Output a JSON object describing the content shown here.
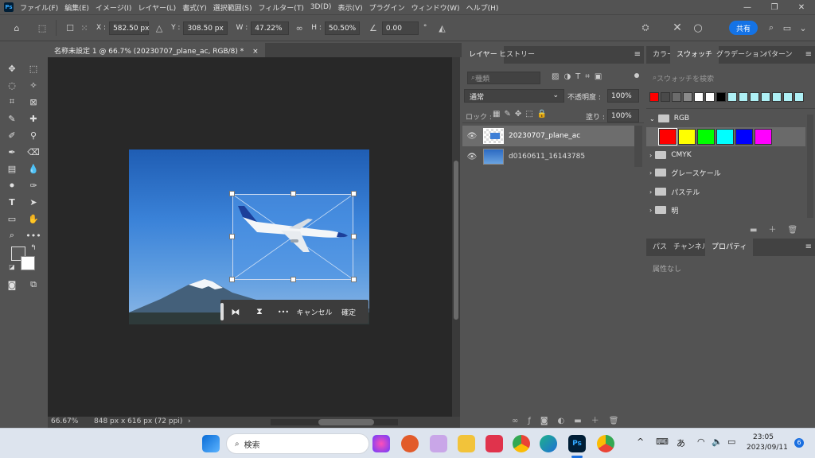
{
  "app": {
    "logo": "Ps"
  },
  "menu": {
    "items": [
      "ファイル(F)",
      "編集(E)",
      "イメージ(I)",
      "レイヤー(L)",
      "書式(Y)",
      "選択範囲(S)",
      "フィルター(T)",
      "3D(D)",
      "表示(V)",
      "プラグイン",
      "ウィンドウ(W)",
      "ヘルプ(H)"
    ]
  },
  "window_controls": {
    "minimize": "—",
    "restore": "❐",
    "close": "✕"
  },
  "options": {
    "x_label": "X :",
    "x_value": "582.50 px",
    "y_label": "Y :",
    "y_value": "308.50 px",
    "w_label": "W :",
    "w_value": "47.22%",
    "h_label": "H :",
    "h_value": "50.50%",
    "angle_value": "0.00",
    "degree": "°",
    "share_label": "共有"
  },
  "document": {
    "tab_title": "名称未設定 1 @ 66.7% (20230707_plane_ac, RGB/8) *",
    "close": "×",
    "zoom": "66.67%",
    "size_info": "848 px x 616 px (72 ppi)",
    "arrow": "›"
  },
  "context_bar": {
    "more": "•••",
    "cancel": "キャンセル",
    "confirm": "確定"
  },
  "layers_panel": {
    "tabs": [
      "レイヤー",
      "ヒストリー"
    ],
    "filter_placeholder": "種類",
    "blend_mode": "通常",
    "opacity_label": "不透明度 :",
    "opacity_value": "100%",
    "lock_label": "ロック :",
    "fill_label": "塗り :",
    "fill_value": "100%",
    "layers": [
      {
        "name": "20230707_plane_ac"
      },
      {
        "name": "d0160611_16143785"
      }
    ]
  },
  "swatches_panel": {
    "tabs": [
      "カラー",
      "スウォッチ",
      "グラデーション",
      "パターン"
    ],
    "search_placeholder": "スウォッチを検索",
    "recent_colors": [
      "#ff0000",
      "#4a4a4a",
      "#6b6b6b",
      "#8a8a8a",
      "#ffffff",
      "#ffffff",
      "#000000",
      "#aef0f5",
      "#aef0f5",
      "#aef0f5",
      "#aef0f5",
      "#aef0f5",
      "#aef0f5",
      "#aef0f5"
    ],
    "groups": [
      {
        "name": "RGB",
        "colors": [
          "#ff0000",
          "#ffff00",
          "#00ff00",
          "#00ffff",
          "#0000ff",
          "#ff00ff"
        ]
      },
      {
        "name": "CMYK"
      },
      {
        "name": "グレースケール"
      },
      {
        "name": "パステル"
      },
      {
        "name": "明"
      }
    ]
  },
  "properties_panel": {
    "tabs": [
      "パス",
      "チャンネル",
      "プロパティ"
    ],
    "empty_text": "属性なし"
  },
  "taskbar": {
    "search_label": "検索",
    "time": "23:05",
    "date": "2023/09/11",
    "ime": "あ",
    "notification_count": "6",
    "tray_chevron": "^"
  }
}
